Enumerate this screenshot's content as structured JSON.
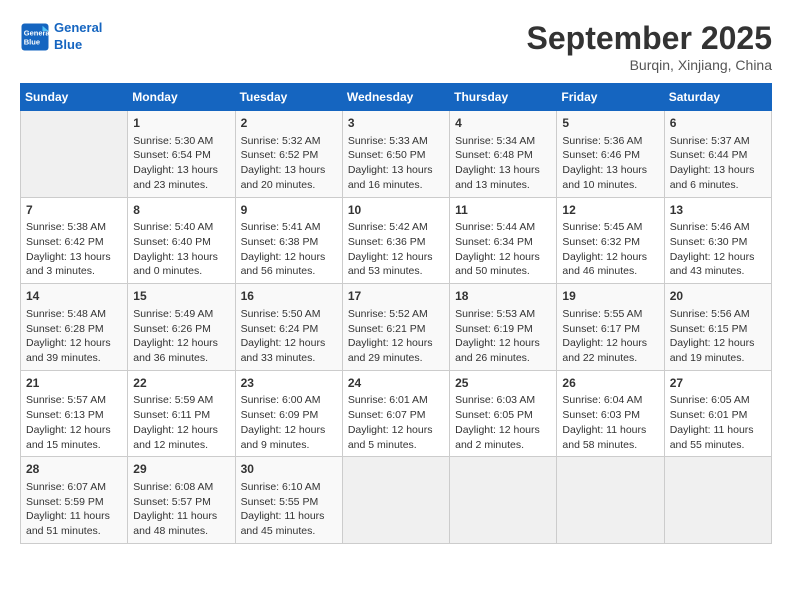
{
  "logo": {
    "line1": "General",
    "line2": "Blue"
  },
  "title": "September 2025",
  "subtitle": "Burqin, Xinjiang, China",
  "headers": [
    "Sunday",
    "Monday",
    "Tuesday",
    "Wednesday",
    "Thursday",
    "Friday",
    "Saturday"
  ],
  "weeks": [
    [
      {
        "day": "",
        "info": ""
      },
      {
        "day": "1",
        "info": "Sunrise: 5:30 AM\nSunset: 6:54 PM\nDaylight: 13 hours\nand 23 minutes."
      },
      {
        "day": "2",
        "info": "Sunrise: 5:32 AM\nSunset: 6:52 PM\nDaylight: 13 hours\nand 20 minutes."
      },
      {
        "day": "3",
        "info": "Sunrise: 5:33 AM\nSunset: 6:50 PM\nDaylight: 13 hours\nand 16 minutes."
      },
      {
        "day": "4",
        "info": "Sunrise: 5:34 AM\nSunset: 6:48 PM\nDaylight: 13 hours\nand 13 minutes."
      },
      {
        "day": "5",
        "info": "Sunrise: 5:36 AM\nSunset: 6:46 PM\nDaylight: 13 hours\nand 10 minutes."
      },
      {
        "day": "6",
        "info": "Sunrise: 5:37 AM\nSunset: 6:44 PM\nDaylight: 13 hours\nand 6 minutes."
      }
    ],
    [
      {
        "day": "7",
        "info": "Sunrise: 5:38 AM\nSunset: 6:42 PM\nDaylight: 13 hours\nand 3 minutes."
      },
      {
        "day": "8",
        "info": "Sunrise: 5:40 AM\nSunset: 6:40 PM\nDaylight: 13 hours\nand 0 minutes."
      },
      {
        "day": "9",
        "info": "Sunrise: 5:41 AM\nSunset: 6:38 PM\nDaylight: 12 hours\nand 56 minutes."
      },
      {
        "day": "10",
        "info": "Sunrise: 5:42 AM\nSunset: 6:36 PM\nDaylight: 12 hours\nand 53 minutes."
      },
      {
        "day": "11",
        "info": "Sunrise: 5:44 AM\nSunset: 6:34 PM\nDaylight: 12 hours\nand 50 minutes."
      },
      {
        "day": "12",
        "info": "Sunrise: 5:45 AM\nSunset: 6:32 PM\nDaylight: 12 hours\nand 46 minutes."
      },
      {
        "day": "13",
        "info": "Sunrise: 5:46 AM\nSunset: 6:30 PM\nDaylight: 12 hours\nand 43 minutes."
      }
    ],
    [
      {
        "day": "14",
        "info": "Sunrise: 5:48 AM\nSunset: 6:28 PM\nDaylight: 12 hours\nand 39 minutes."
      },
      {
        "day": "15",
        "info": "Sunrise: 5:49 AM\nSunset: 6:26 PM\nDaylight: 12 hours\nand 36 minutes."
      },
      {
        "day": "16",
        "info": "Sunrise: 5:50 AM\nSunset: 6:24 PM\nDaylight: 12 hours\nand 33 minutes."
      },
      {
        "day": "17",
        "info": "Sunrise: 5:52 AM\nSunset: 6:21 PM\nDaylight: 12 hours\nand 29 minutes."
      },
      {
        "day": "18",
        "info": "Sunrise: 5:53 AM\nSunset: 6:19 PM\nDaylight: 12 hours\nand 26 minutes."
      },
      {
        "day": "19",
        "info": "Sunrise: 5:55 AM\nSunset: 6:17 PM\nDaylight: 12 hours\nand 22 minutes."
      },
      {
        "day": "20",
        "info": "Sunrise: 5:56 AM\nSunset: 6:15 PM\nDaylight: 12 hours\nand 19 minutes."
      }
    ],
    [
      {
        "day": "21",
        "info": "Sunrise: 5:57 AM\nSunset: 6:13 PM\nDaylight: 12 hours\nand 15 minutes."
      },
      {
        "day": "22",
        "info": "Sunrise: 5:59 AM\nSunset: 6:11 PM\nDaylight: 12 hours\nand 12 minutes."
      },
      {
        "day": "23",
        "info": "Sunrise: 6:00 AM\nSunset: 6:09 PM\nDaylight: 12 hours\nand 9 minutes."
      },
      {
        "day": "24",
        "info": "Sunrise: 6:01 AM\nSunset: 6:07 PM\nDaylight: 12 hours\nand 5 minutes."
      },
      {
        "day": "25",
        "info": "Sunrise: 6:03 AM\nSunset: 6:05 PM\nDaylight: 12 hours\nand 2 minutes."
      },
      {
        "day": "26",
        "info": "Sunrise: 6:04 AM\nSunset: 6:03 PM\nDaylight: 11 hours\nand 58 minutes."
      },
      {
        "day": "27",
        "info": "Sunrise: 6:05 AM\nSunset: 6:01 PM\nDaylight: 11 hours\nand 55 minutes."
      }
    ],
    [
      {
        "day": "28",
        "info": "Sunrise: 6:07 AM\nSunset: 5:59 PM\nDaylight: 11 hours\nand 51 minutes."
      },
      {
        "day": "29",
        "info": "Sunrise: 6:08 AM\nSunset: 5:57 PM\nDaylight: 11 hours\nand 48 minutes."
      },
      {
        "day": "30",
        "info": "Sunrise: 6:10 AM\nSunset: 5:55 PM\nDaylight: 11 hours\nand 45 minutes."
      },
      {
        "day": "",
        "info": ""
      },
      {
        "day": "",
        "info": ""
      },
      {
        "day": "",
        "info": ""
      },
      {
        "day": "",
        "info": ""
      }
    ]
  ]
}
